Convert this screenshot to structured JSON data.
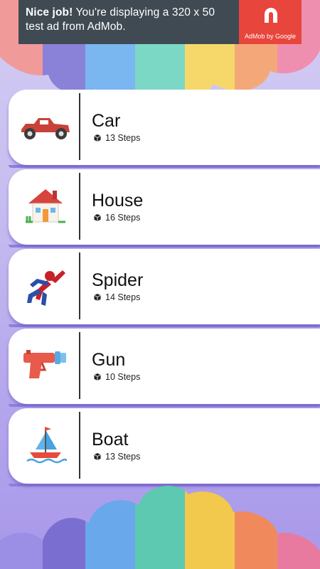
{
  "ad": {
    "headline": "Nice job!",
    "text": " You're displaying a 320 x 50 test ad from AdMob.",
    "brand": "AdMob by Google",
    "accent": "#e8453c"
  },
  "items": [
    {
      "title": "Car",
      "steps": "13 Steps",
      "icon": "car-icon"
    },
    {
      "title": "House",
      "steps": "16 Steps",
      "icon": "house-icon"
    },
    {
      "title": "Spider",
      "steps": "14 Steps",
      "icon": "spider-icon"
    },
    {
      "title": "Gun",
      "steps": "10 Steps",
      "icon": "gun-icon"
    },
    {
      "title": "Boat",
      "steps": "13 Steps",
      "icon": "boat-icon"
    }
  ],
  "colors": {
    "background": "#c7bdf0",
    "card": "#ffffff",
    "card_shadow": "#8f7fe0"
  }
}
